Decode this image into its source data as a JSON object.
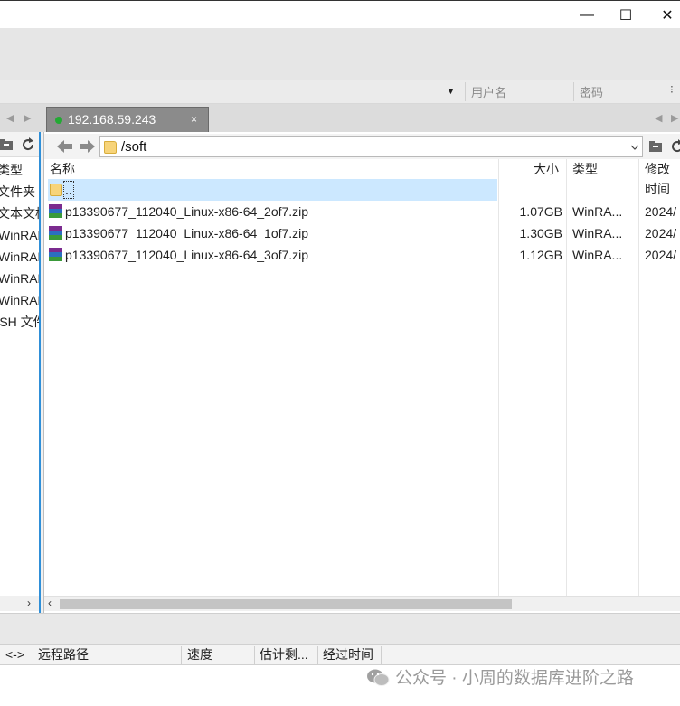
{
  "window": {
    "controls": {
      "minimize": "—",
      "maximize": "☐",
      "close": "✕"
    }
  },
  "connection": {
    "username_placeholder": "用户名",
    "password_placeholder": "密码"
  },
  "tabs": [
    {
      "label": "192.168.59.243",
      "status_color": "#22aa33",
      "close": "×"
    }
  ],
  "left_panel": {
    "header": "类型",
    "items": [
      "文件夹",
      "文本文档",
      "WinRAR",
      "WinRAR",
      "WinRAR",
      "WinRAR",
      "SSH 文件"
    ]
  },
  "right_panel": {
    "path": "/soft",
    "columns": {
      "name": "名称",
      "size": "大小",
      "type": "类型",
      "modified": "修改时间"
    },
    "rows": [
      {
        "name": "..",
        "size": "",
        "type": "",
        "modified": "",
        "icon": "folder-icon",
        "selected": true
      },
      {
        "name": "p13390677_112040_Linux-x86-64_2of7.zip",
        "size": "1.07GB",
        "type": "WinRA...",
        "modified": "2024/",
        "icon": "winrar-icon"
      },
      {
        "name": "p13390677_112040_Linux-x86-64_1of7.zip",
        "size": "1.30GB",
        "type": "WinRA...",
        "modified": "2024/",
        "icon": "winrar-icon"
      },
      {
        "name": "p13390677_112040_Linux-x86-64_3of7.zip",
        "size": "1.12GB",
        "type": "WinRA...",
        "modified": "2024/",
        "icon": "winrar-icon"
      }
    ]
  },
  "transfers": {
    "columns": {
      "direction": "<->",
      "remote_path": "远程路径",
      "speed": "速度",
      "remaining": "估计剩...",
      "elapsed": "经过时间"
    }
  },
  "watermark": "公众号 · 小周的数据库进阶之路",
  "colors": {
    "selection": "#cce8ff",
    "active_border": "#2f8fd8",
    "tab_bg": "#8b8b8b"
  }
}
